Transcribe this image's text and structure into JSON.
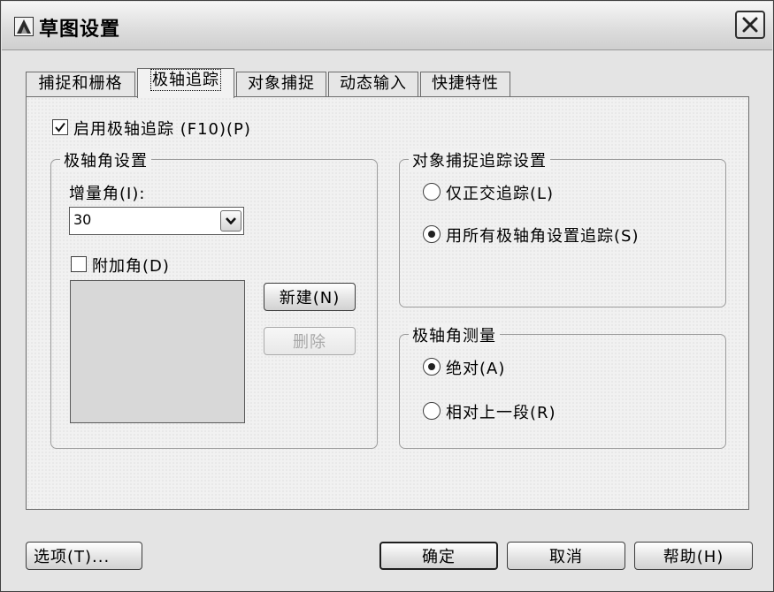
{
  "window": {
    "title": "草图设置"
  },
  "tabs": [
    {
      "label": "捕捉和栅格"
    },
    {
      "label": "极轴追踪"
    },
    {
      "label": "对象捕捉"
    },
    {
      "label": "动态输入"
    },
    {
      "label": "快捷特性"
    }
  ],
  "active_tab": "极轴追踪",
  "enable_polar": {
    "label": "启用极轴追踪 (F10)(P)",
    "checked": true
  },
  "polar_angle_settings": {
    "legend": "极轴角设置",
    "increment_label": "增量角(I):",
    "increment_value": "30",
    "additional_label": "附加角(D)",
    "additional_checked": false,
    "new_button": "新建(N)",
    "delete_button": "删除"
  },
  "object_snap_tracking": {
    "legend": "对象捕捉追踪设置",
    "option_ortho": "仅正交追踪(L)",
    "option_all": "用所有极轴角设置追踪(S)",
    "selected": "option_all"
  },
  "polar_measure": {
    "legend": "极轴角测量",
    "option_absolute": "绝对(A)",
    "option_relative": "相对上一段(R)",
    "selected": "option_absolute"
  },
  "footer": {
    "options_button": "选项(T)...",
    "ok_button": "确定",
    "cancel_button": "取消",
    "help_button": "帮助(H)"
  }
}
